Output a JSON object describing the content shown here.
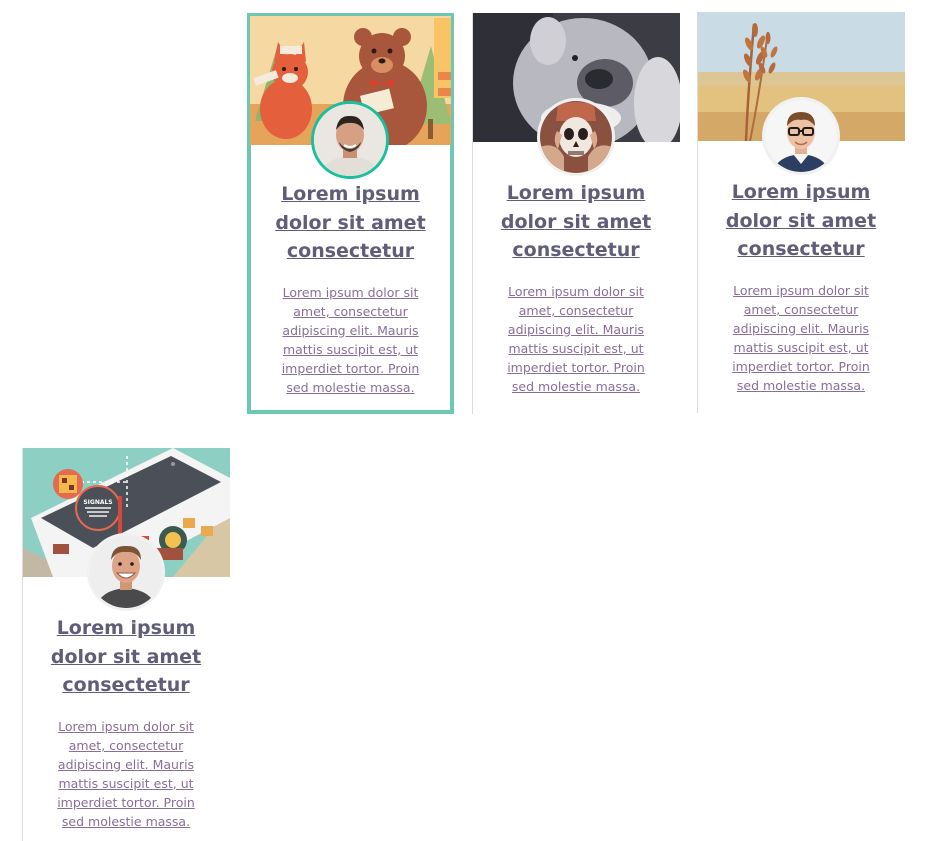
{
  "cards": [
    {
      "title": "Lorem ipsum dolor sit amet consectetur",
      "description": "Lorem ipsum dolor sit amet, consectetur adipiscing elit. Mauris mattis suscipit est, ut imperdiet tortor. Proin sed molestie massa.",
      "cover": "illustrated-animals-image",
      "avatar": "man-portrait-avatar",
      "selected": true
    },
    {
      "title": "Lorem ipsum dolor sit amet consectetur",
      "description": "Lorem ipsum dolor sit amet, consectetur adipiscing elit. Mauris mattis suscipit est, ut imperdiet tortor. Proin sed molestie massa.",
      "cover": "white-bear-image",
      "avatar": "skull-mask-avatar",
      "selected": false
    },
    {
      "title": "Lorem ipsum dolor sit amet consectetur",
      "description": "Lorem ipsum dolor sit amet, consectetur adipiscing elit. Mauris mattis suscipit est, ut imperdiet tortor. Proin sed molestie massa.",
      "cover": "wheat-field-image",
      "avatar": "man-glasses-avatar",
      "selected": false
    },
    {
      "title": "Lorem ipsum dolor sit amet consectetur",
      "description": "Lorem ipsum dolor sit amet, consectetur adipiscing elit. Mauris mattis suscipit est, ut imperdiet tortor. Proin sed molestie massa.",
      "cover": "smartphone-illustration-image",
      "cover_text": "SIGNALS",
      "avatar": "smiling-man-avatar",
      "selected": false
    }
  ],
  "colors": {
    "accent": "#6cc7b3",
    "avatar_ring": "#1bbf9d",
    "title": "#5f5d78",
    "description": "#8a6e9a",
    "divider": "#dcdcdc"
  }
}
